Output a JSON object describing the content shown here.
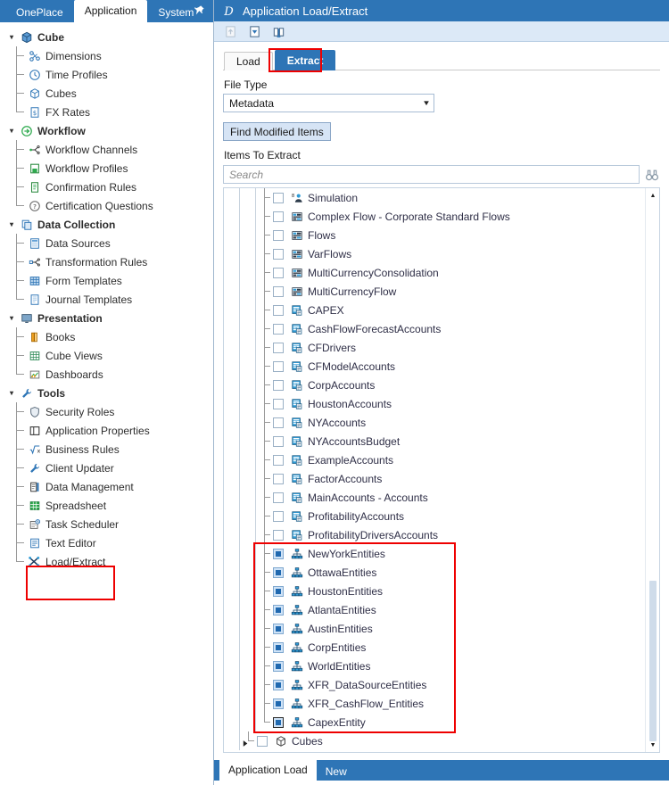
{
  "sidebar": {
    "tabs": [
      {
        "label": "OnePlace",
        "active": false
      },
      {
        "label": "Application",
        "active": true
      },
      {
        "label": "System",
        "active": false
      }
    ],
    "pin_icon": "pin-icon",
    "groups": [
      {
        "label": "Cube",
        "icon": "cube-icon",
        "expanded": true,
        "items": [
          {
            "label": "Dimensions",
            "icon": "dimensions-icon"
          },
          {
            "label": "Time Profiles",
            "icon": "clock-icon"
          },
          {
            "label": "Cubes",
            "icon": "cube-icon"
          },
          {
            "label": "FX Rates",
            "icon": "currency-page-icon"
          }
        ]
      },
      {
        "label": "Workflow",
        "icon": "workflow-arrow-icon",
        "expanded": true,
        "items": [
          {
            "label": "Workflow Channels",
            "icon": "channels-icon"
          },
          {
            "label": "Workflow Profiles",
            "icon": "profile-save-icon"
          },
          {
            "label": "Confirmation Rules",
            "icon": "confirmation-icon"
          },
          {
            "label": "Certification Questions",
            "icon": "question-circle-icon"
          }
        ]
      },
      {
        "label": "Data Collection",
        "icon": "data-collection-icon",
        "expanded": true,
        "items": [
          {
            "label": "Data Sources",
            "icon": "data-source-icon"
          },
          {
            "label": "Transformation Rules",
            "icon": "transformation-icon"
          },
          {
            "label": "Form Templates",
            "icon": "form-grid-icon"
          },
          {
            "label": "Journal Templates",
            "icon": "journal-icon"
          }
        ]
      },
      {
        "label": "Presentation",
        "icon": "presentation-icon",
        "expanded": true,
        "items": [
          {
            "label": "Books",
            "icon": "books-icon"
          },
          {
            "label": "Cube Views",
            "icon": "cube-view-grid-icon"
          },
          {
            "label": "Dashboards",
            "icon": "dashboard-chart-icon"
          }
        ]
      },
      {
        "label": "Tools",
        "icon": "wrench-icon",
        "expanded": true,
        "items": [
          {
            "label": "Security Roles",
            "icon": "shield-icon"
          },
          {
            "label": "Application Properties",
            "icon": "window-properties-icon"
          },
          {
            "label": "Business Rules",
            "icon": "sqrt-x-icon"
          },
          {
            "label": "Client Updater",
            "icon": "wrench-icon"
          },
          {
            "label": "Data Management",
            "icon": "data-management-icon"
          },
          {
            "label": "Spreadsheet",
            "icon": "spreadsheet-icon"
          },
          {
            "label": "Task Scheduler",
            "icon": "task-scheduler-icon"
          },
          {
            "label": "Text Editor",
            "icon": "text-editor-icon"
          },
          {
            "label": "Load/Extract",
            "icon": "load-extract-icon",
            "annotated": true
          }
        ]
      }
    ]
  },
  "main": {
    "title": "Application Load/Extract",
    "title_icon": "oneplace-logo-icon",
    "toolbar": [
      {
        "name": "extract-up-icon",
        "label": "",
        "disabled": true
      },
      {
        "name": "load-down-icon",
        "label": "",
        "disabled": false
      },
      {
        "name": "library-book-icon",
        "label": "",
        "disabled": false
      }
    ],
    "tabs": [
      {
        "label": "Load",
        "active": false
      },
      {
        "label": "Extract",
        "active": true
      }
    ],
    "file_type": {
      "label": "File Type",
      "value": "Metadata",
      "caret_icon": "chevron-down-icon"
    },
    "find_modified_label": "Find Modified Items",
    "items_to_extract_label": "Items To Extract",
    "search": {
      "placeholder": "Search",
      "value": "",
      "icon": "binoculars-search-icon"
    },
    "scrollbar": {
      "up_icon": "scroll-up-arrow-icon",
      "down_icon": "scroll-down-arrow-icon"
    },
    "tree": [
      {
        "label": "Simulation",
        "icon": "simulation-icon",
        "checked": false,
        "depth": 2,
        "expandable": false
      },
      {
        "label": "Complex Flow - Corporate Standard Flows",
        "icon": "flow-icon",
        "checked": false,
        "depth": 2,
        "expandable": false
      },
      {
        "label": "Flows",
        "icon": "flow-icon",
        "checked": false,
        "depth": 2,
        "expandable": false
      },
      {
        "label": "VarFlows",
        "icon": "flow-icon",
        "checked": false,
        "depth": 2,
        "expandable": false
      },
      {
        "label": "MultiCurrencyConsolidation",
        "icon": "flow-icon",
        "checked": false,
        "depth": 2,
        "expandable": false
      },
      {
        "label": "MultiCurrencyFlow",
        "icon": "flow-icon",
        "checked": false,
        "depth": 2,
        "expandable": false
      },
      {
        "label": "CAPEX",
        "icon": "account-icon",
        "checked": false,
        "depth": 2,
        "expandable": false
      },
      {
        "label": "CashFlowForecastAccounts",
        "icon": "account-icon",
        "checked": false,
        "depth": 2,
        "expandable": false
      },
      {
        "label": "CFDrivers",
        "icon": "account-icon",
        "checked": false,
        "depth": 2,
        "expandable": false
      },
      {
        "label": "CFModelAccounts",
        "icon": "account-icon",
        "checked": false,
        "depth": 2,
        "expandable": false
      },
      {
        "label": "CorpAccounts",
        "icon": "account-icon",
        "checked": false,
        "depth": 2,
        "expandable": false
      },
      {
        "label": "HoustonAccounts",
        "icon": "account-icon",
        "checked": false,
        "depth": 2,
        "expandable": false
      },
      {
        "label": "NYAccounts",
        "icon": "account-icon",
        "checked": false,
        "depth": 2,
        "expandable": false
      },
      {
        "label": "NYAccountsBudget",
        "icon": "account-icon",
        "checked": false,
        "depth": 2,
        "expandable": false
      },
      {
        "label": "ExampleAccounts",
        "icon": "account-icon",
        "checked": false,
        "depth": 2,
        "expandable": false
      },
      {
        "label": "FactorAccounts",
        "icon": "account-icon",
        "checked": false,
        "depth": 2,
        "expandable": false
      },
      {
        "label": "MainAccounts - Accounts",
        "icon": "account-icon",
        "checked": false,
        "depth": 2,
        "expandable": false
      },
      {
        "label": "ProfitabilityAccounts",
        "icon": "account-icon",
        "checked": false,
        "depth": 2,
        "expandable": false
      },
      {
        "label": "ProfitabilityDriversAccounts",
        "icon": "account-icon",
        "checked": false,
        "depth": 2,
        "expandable": false
      },
      {
        "label": "NewYorkEntities",
        "icon": "entity-icon",
        "checked": true,
        "depth": 2,
        "expandable": false
      },
      {
        "label": "OttawaEntities",
        "icon": "entity-icon",
        "checked": true,
        "depth": 2,
        "expandable": false
      },
      {
        "label": "HoustonEntities",
        "icon": "entity-icon",
        "checked": true,
        "depth": 2,
        "expandable": false
      },
      {
        "label": "AtlantaEntities",
        "icon": "entity-icon",
        "checked": true,
        "depth": 2,
        "expandable": false
      },
      {
        "label": "AustinEntities",
        "icon": "entity-icon",
        "checked": true,
        "depth": 2,
        "expandable": false
      },
      {
        "label": "CorpEntities",
        "icon": "entity-icon",
        "checked": true,
        "depth": 2,
        "expandable": false
      },
      {
        "label": "WorldEntities",
        "icon": "entity-icon",
        "checked": true,
        "depth": 2,
        "expandable": false
      },
      {
        "label": "XFR_DataSourceEntities",
        "icon": "entity-icon",
        "checked": true,
        "depth": 2,
        "expandable": false
      },
      {
        "label": "XFR_CashFlow_Entities",
        "icon": "entity-icon",
        "checked": true,
        "depth": 2,
        "expandable": false
      },
      {
        "label": "CapexEntity",
        "icon": "entity-icon",
        "checked": true,
        "focused": true,
        "depth": 2,
        "expandable": false,
        "last": true
      },
      {
        "label": "Cubes",
        "icon": "cube-icon",
        "checked": false,
        "depth": 1,
        "expandable": true,
        "last": true
      }
    ],
    "bottom_tabs": [
      {
        "label": "Application Load",
        "active": true
      },
      {
        "label": "New",
        "active": false
      }
    ]
  },
  "colors": {
    "brand_blue": "#2E75B6",
    "toolbar_blue": "#dce9f7",
    "annotation_red": "#ee0000",
    "checkbox_fill": "#2069b0"
  }
}
